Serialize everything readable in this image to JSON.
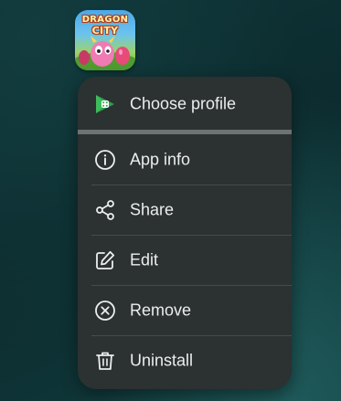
{
  "app": {
    "name_line1": "DRAGON",
    "name_line2": "CITY",
    "icon": "dragon-city-app-icon"
  },
  "menu": {
    "items": [
      {
        "label": "Choose profile",
        "icon": "google-play-games-icon"
      },
      {
        "label": "App info",
        "icon": "info-icon"
      },
      {
        "label": "Share",
        "icon": "share-icon"
      },
      {
        "label": "Edit",
        "icon": "edit-icon"
      },
      {
        "label": "Remove",
        "icon": "remove-icon"
      },
      {
        "label": "Uninstall",
        "icon": "trash-icon"
      }
    ]
  },
  "colors": {
    "menu_background": "#2c3132",
    "menu_text": "#eceeee",
    "accent_green": "#2fa24f",
    "wallpaper": "#0f3437"
  }
}
